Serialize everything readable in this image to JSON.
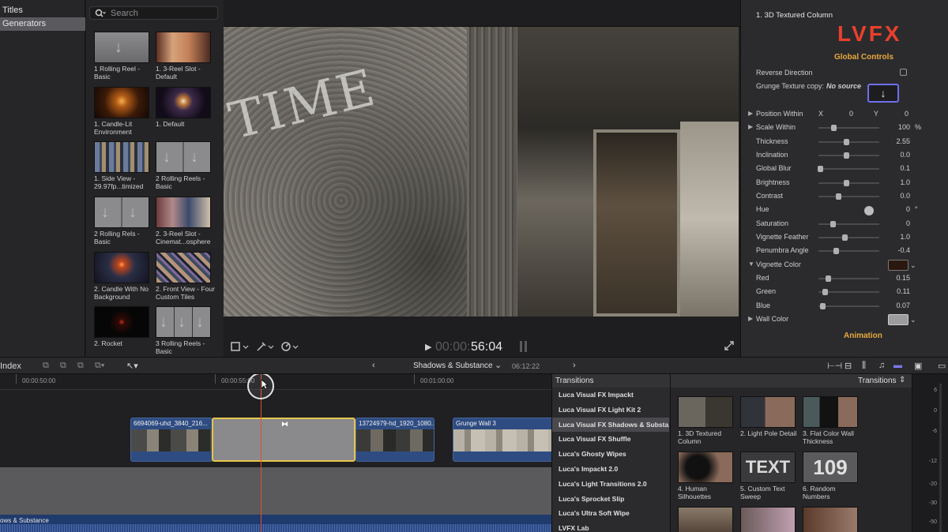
{
  "sidebar": {
    "items": [
      {
        "label": "Titles"
      },
      {
        "label": "Generators"
      }
    ]
  },
  "browser": {
    "search_placeholder": "Search",
    "tiles": [
      {
        "label": "1 Rolling Reel - Basic"
      },
      {
        "label": "1. 3-Reel Slot - Default"
      },
      {
        "label": "1. Candle-Lit Environment"
      },
      {
        "label": "1. Default"
      },
      {
        "label": "1. Side View - 29.97fp...timized"
      },
      {
        "label": "2 Rolling Reels - Basic"
      },
      {
        "label": "2 Rolling Rels - Basic"
      },
      {
        "label": "2. 3-Reel Slot - Cinemat...osphere"
      },
      {
        "label": "2. Candle With No Background"
      },
      {
        "label": "2. Front View - Four Custom Tiles"
      },
      {
        "label": "2. Rocket"
      },
      {
        "label": "3 Rolling Reels - Basic"
      }
    ]
  },
  "viewer": {
    "overlay_text": "TIME",
    "timecode_dim": "00:00:",
    "timecode_bright": "56:04"
  },
  "inspector": {
    "title": "1. 3D Textured Column",
    "logo": "LVFX",
    "section": "Global Controls",
    "reverse_label": "Reverse Direction",
    "grunge_label": "Grunge Texture copy:",
    "grunge_value": "No source",
    "params": [
      {
        "label": "Position Within",
        "x_label": "X",
        "x": "0",
        "y_label": "Y",
        "y": "0",
        "slider": null,
        "expand": true
      },
      {
        "label": "Scale Within",
        "value": "100",
        "unit": "%",
        "slider": 0.25,
        "expand": true
      },
      {
        "label": "Thickness",
        "value": "2.55",
        "slider": 0.45
      },
      {
        "label": "Inclination",
        "value": "0.0",
        "slider": 0.45
      },
      {
        "label": "Global Blur",
        "value": "0.1",
        "slider": 0.03
      },
      {
        "label": "Brightness",
        "value": "1.0",
        "slider": 0.45
      },
      {
        "label": "Contrast",
        "value": "0.0",
        "slider": 0.32
      },
      {
        "label": "Hue",
        "value": "0",
        "unit": "°",
        "slider": null
      },
      {
        "label": "Saturation",
        "value": "0",
        "slider": 0.24
      },
      {
        "label": "Vignette Feather",
        "value": "1.0",
        "slider": 0.43
      },
      {
        "label": "Penumbra Angle",
        "value": "-0.4",
        "slider": 0.28
      },
      {
        "label": "Vignette Color",
        "slider": null,
        "expand": true,
        "open": true
      },
      {
        "label": "Red",
        "value": "0.15",
        "slider": 0.15,
        "indent": true
      },
      {
        "label": "Green",
        "value": "0.11",
        "slider": 0.11,
        "indent": true
      },
      {
        "label": "Blue",
        "value": "0.07",
        "slider": 0.07,
        "indent": true
      },
      {
        "label": "Wall Color",
        "slider": null,
        "expand": true
      }
    ],
    "animation_label": "Animation"
  },
  "timeline_bar": {
    "index_label": "Index",
    "project_name": "Shadows & Substance",
    "duration": "06:12:22"
  },
  "timeline": {
    "ruler": [
      "00:00:50:00",
      "00:00:55:00",
      "00:01:00:00"
    ],
    "clips": [
      {
        "name": "6694069-uhd_3840_216..."
      },
      {
        "name": "13724979-hd_1920_1080..."
      },
      {
        "name": "Grunge Wall 3"
      }
    ],
    "audio_label": "ows & Substance"
  },
  "transitions": {
    "header": "Transitions",
    "grid_title": "Transitions",
    "list": [
      {
        "label": "Luca Visual FX Impackt"
      },
      {
        "label": "Luca Visual FX Light Kit 2"
      },
      {
        "label": "Luca Visual FX Shadows & Substa...",
        "selected": true
      },
      {
        "label": "Luca Visual FX Shuffle"
      },
      {
        "label": "Luca's Ghosty Wipes"
      },
      {
        "label": "Luca's Impackt 2.0"
      },
      {
        "label": "Luca's Light Transitions 2.0"
      },
      {
        "label": "Luca's Sprocket Slip"
      },
      {
        "label": "Luca's Ultra Soft Wipe"
      },
      {
        "label": "LVFX Lab"
      }
    ],
    "items": [
      {
        "label": "1. 3D Textured Column"
      },
      {
        "label": "2. Light Pole Detail"
      },
      {
        "label": "3. Flat Color Wall Thickness"
      },
      {
        "label": "4. Human Silhouettes"
      },
      {
        "label": "5. Custom Text Sweep"
      },
      {
        "label": "6. Random Numbers"
      }
    ],
    "thumb_text_5": "TEXT",
    "thumb_text_6": "109"
  },
  "meters": {
    "labels": [
      "6",
      "0",
      "-6",
      "-12",
      "-20",
      "-30",
      "-50"
    ]
  }
}
